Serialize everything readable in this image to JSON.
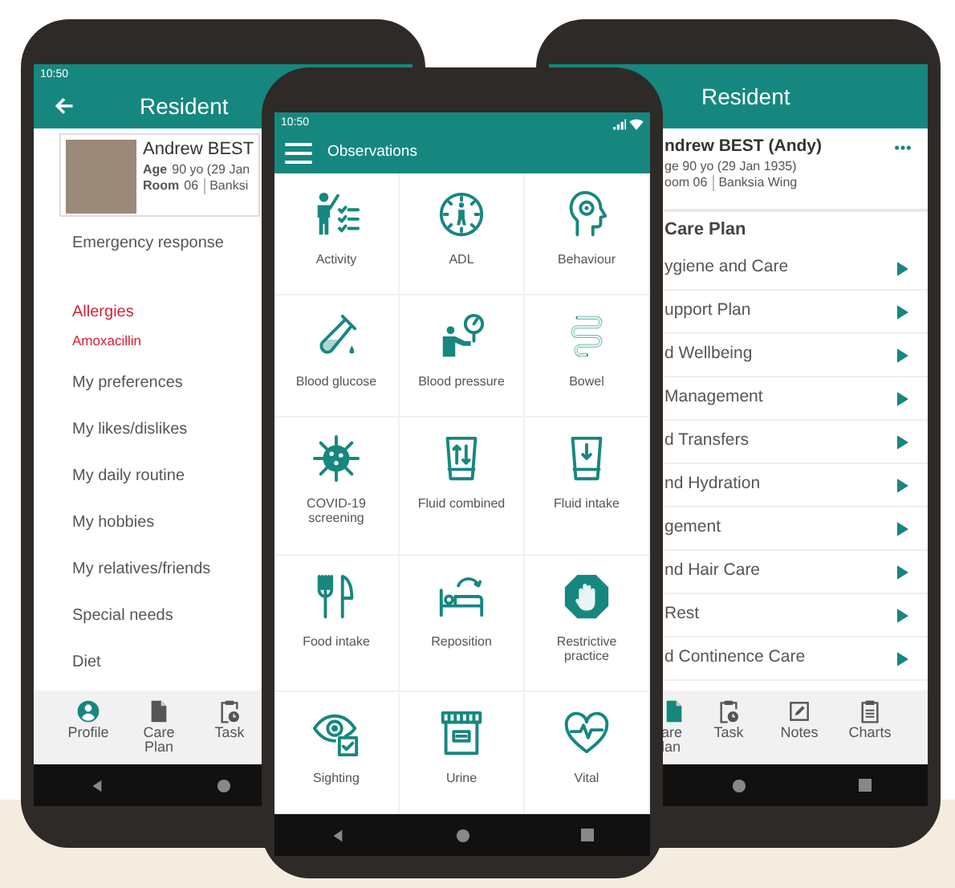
{
  "left_phone": {
    "status_time": "10:50",
    "title": "Resident",
    "profile": {
      "name": "Andrew BEST",
      "age_label": "Age",
      "age": "90 yo (29 Jan",
      "room_label": "Room",
      "room": "06",
      "wing": "Banksi"
    },
    "items": [
      {
        "text": "Emergency response",
        "kind": "item"
      },
      {
        "text": "Allergies",
        "kind": "alert-heading"
      },
      {
        "text": "Amoxacillin",
        "kind": "alert"
      },
      {
        "text": "My preferences",
        "kind": "item"
      },
      {
        "text": "My likes/dislikes",
        "kind": "item"
      },
      {
        "text": "My daily routine",
        "kind": "item"
      },
      {
        "text": "My hobbies",
        "kind": "item"
      },
      {
        "text": "My relatives/friends",
        "kind": "item"
      },
      {
        "text": "Special needs",
        "kind": "item"
      },
      {
        "text": "Diet",
        "kind": "item"
      }
    ],
    "nav": [
      {
        "label": "Profile",
        "selected": true
      },
      {
        "label": "Care Plan",
        "selected": false
      },
      {
        "label": "Task",
        "selected": false
      }
    ]
  },
  "center_phone": {
    "status_time": "10:50",
    "title": "Observations",
    "observations": [
      {
        "label": "Activity"
      },
      {
        "label": "ADL"
      },
      {
        "label": "Behaviour"
      },
      {
        "label": "Blood glucose"
      },
      {
        "label": "Blood pressure"
      },
      {
        "label": "Bowel"
      },
      {
        "label": "COVID-19 screening"
      },
      {
        "label": "Fluid combined"
      },
      {
        "label": "Fluid intake"
      },
      {
        "label": "Food intake"
      },
      {
        "label": "Reposition"
      },
      {
        "label": "Restrictive practice"
      },
      {
        "label": "Sighting"
      },
      {
        "label": "Urine"
      },
      {
        "label": "Vital"
      }
    ]
  },
  "right_phone": {
    "title": "Resident",
    "profile": {
      "name": "ndrew BEST (Andy)",
      "age": "ge 90 yo (29 Jan 1935)",
      "room": "oom 06",
      "wing": "Banksia Wing"
    },
    "section": "Care Plan",
    "items": [
      {
        "text": "ygiene and Care"
      },
      {
        "text": "upport Plan"
      },
      {
        "text": "d Wellbeing"
      },
      {
        "text": "Management"
      },
      {
        "text": "d Transfers"
      },
      {
        "text": "nd Hydration"
      },
      {
        "text": "gement"
      },
      {
        "text": "nd Hair Care"
      },
      {
        "text": "Rest"
      },
      {
        "text": "d Continence Care"
      }
    ],
    "nav": [
      {
        "label": "are lan",
        "selected": true
      },
      {
        "label": "Task",
        "selected": false
      },
      {
        "label": "Notes",
        "selected": false
      },
      {
        "label": "Charts",
        "selected": false
      }
    ]
  }
}
